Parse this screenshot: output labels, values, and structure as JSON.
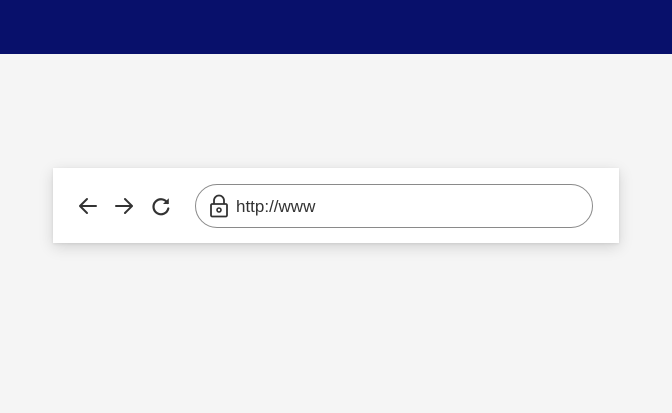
{
  "colors": {
    "header_band": "#08106b",
    "page_background": "#f5f5f5",
    "toolbar_background": "#ffffff",
    "icon_color": "#333333",
    "address_border": "#8a8a8a"
  },
  "toolbar": {
    "icons": {
      "back": "arrow-left-icon",
      "forward": "arrow-right-icon",
      "reload": "reload-icon",
      "secure": "lock-icon"
    },
    "address": {
      "value": "http://www"
    }
  }
}
